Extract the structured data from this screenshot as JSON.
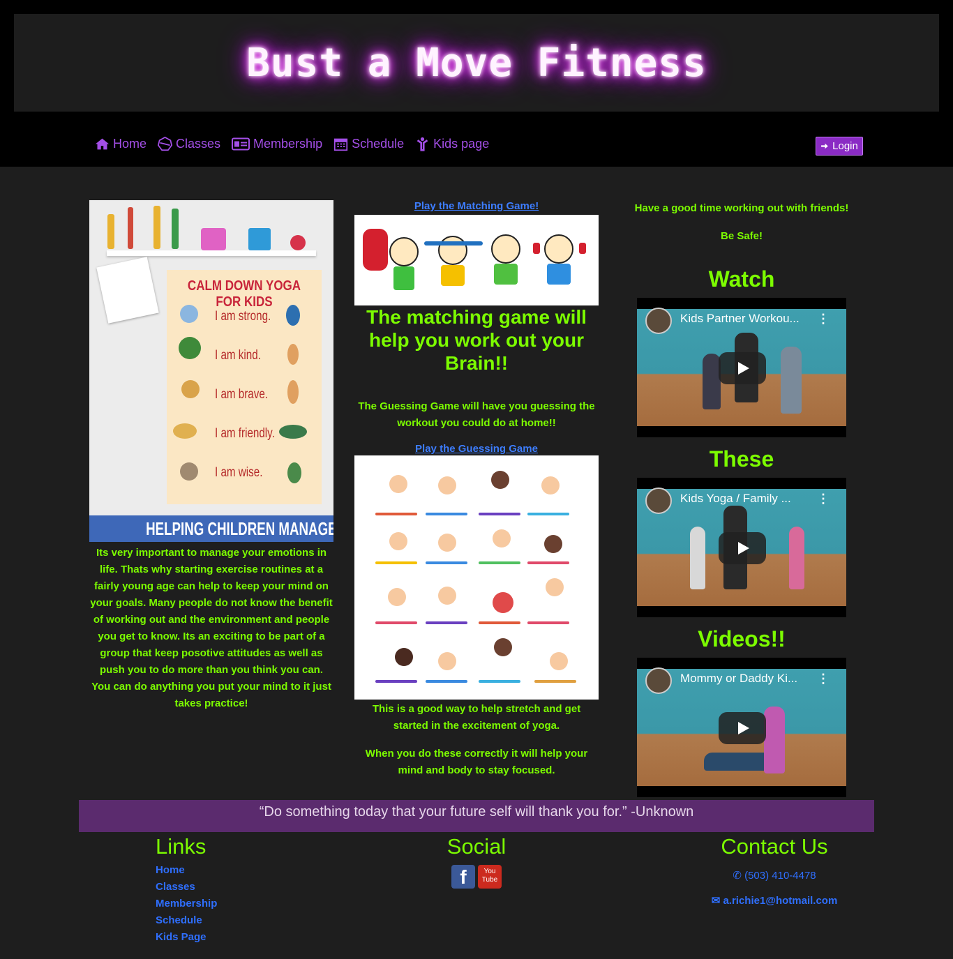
{
  "site_title": "Bust a Move Fitness",
  "nav": [
    {
      "label": "Home",
      "icon": "home-icon"
    },
    {
      "label": "Classes",
      "icon": "dumbbell-icon"
    },
    {
      "label": "Membership",
      "icon": "id-card-icon"
    },
    {
      "label": "Schedule",
      "icon": "calendar-icon"
    },
    {
      "label": "Kids page",
      "icon": "child-icon"
    }
  ],
  "login_label": "Login",
  "col1": {
    "poster_title": "CALM DOWN YOGA FOR KIDS",
    "poster_lines": [
      "I am strong.",
      "I am kind.",
      "I am brave.",
      "I am friendly.",
      "I am wise."
    ],
    "poster_footer": "HELPING CHILDREN MANAGE BIG EMOTIONS",
    "paragraph": "Its very important to manage your emotions in life. Thats why starting exercise routines at a fairly young age can help to keep your mind on your goals. Many people do not know the benefit of working out and the environment and people you get to know. Its an exciting to be part of a group that keep posotive attitudes as well as push you to do more than you think you can. You can do anything you put your mind to it just takes practice!"
  },
  "col2": {
    "matching_link": "Play the Matching Game!",
    "matching_heading": "The matching game will help you work out your Brain!!",
    "guessing_text": "The Guessing Game will have you guessing the workout you could do at home!!",
    "guessing_link": "Play the Guessing Game",
    "stretch_text": "This is a good way to help stretch and get started in the excitement of yoga.",
    "focus_text": "When you do these correctly it will help your mind and body to stay focused."
  },
  "col3": {
    "friends_text": "Have a good time working out with friends!",
    "safe_text": "Be Safe!",
    "headings": [
      "Watch",
      "These",
      "Videos!!"
    ],
    "videos": [
      {
        "title": "Kids Partner Workou..."
      },
      {
        "title": "Kids Yoga / Family ..."
      },
      {
        "title": "Mommy or Daddy Ki..."
      }
    ]
  },
  "quote": "“Do something today that your future self will thank you for.” -Unknown",
  "footer": {
    "links_heading": "Links",
    "links": [
      "Home",
      "Classes",
      "Membership",
      "Schedule",
      "Kids Page"
    ],
    "social_heading": "Social",
    "facebook_label": "f",
    "youtube_label": "You Tube",
    "contact_heading": "Contact Us",
    "phone": "(503) 410-4478",
    "email": "a.richie1@hotmail.com"
  },
  "colors": {
    "accent": "#a44fe8",
    "green": "#7cfc00",
    "quote_bg": "#5b2b6e"
  }
}
